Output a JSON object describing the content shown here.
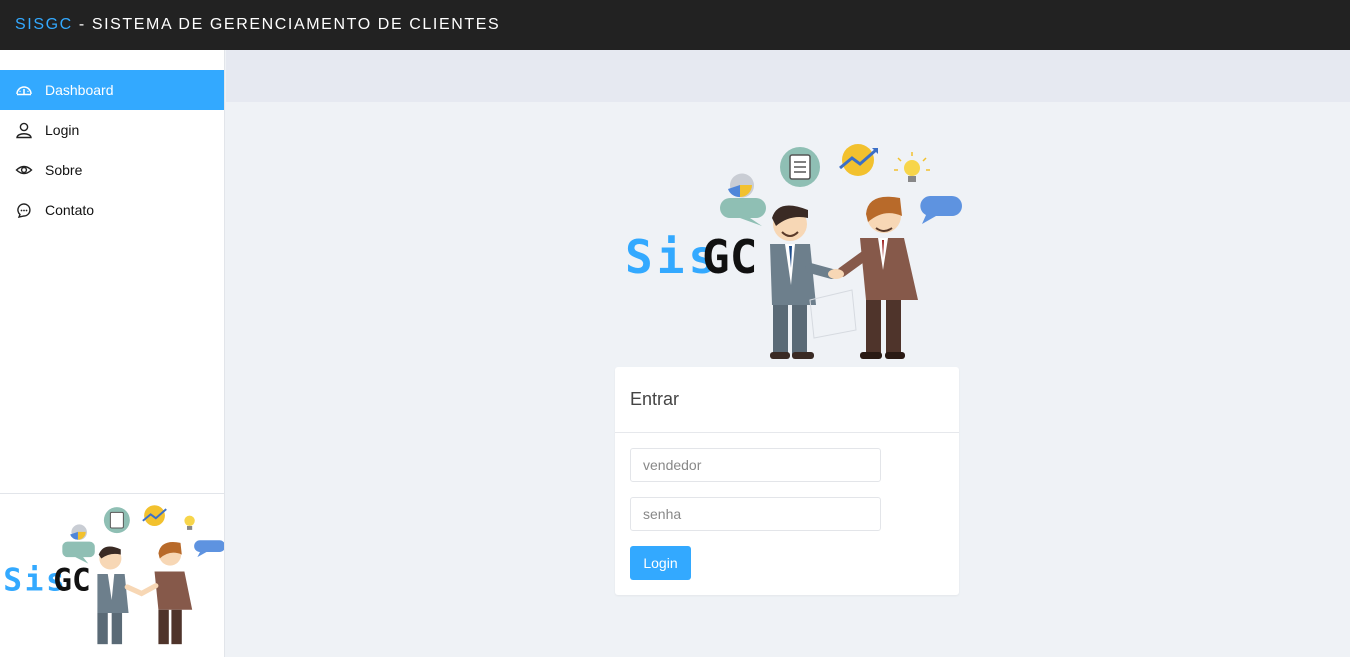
{
  "header": {
    "brand_accent": "SISGC",
    "brand_rest": " - SISTEMA DE GERENCIAMENTO DE CLIENTES"
  },
  "sidebar": {
    "items": [
      {
        "label": "Dashboard",
        "icon": "dashboard-icon",
        "active": true
      },
      {
        "label": "Login",
        "icon": "user-icon",
        "active": false
      },
      {
        "label": "Sobre",
        "icon": "eye-icon",
        "active": false
      },
      {
        "label": "Contato",
        "icon": "chat-icon",
        "active": false
      }
    ]
  },
  "logo": {
    "part1": "Sis",
    "part2": "GC"
  },
  "login": {
    "title": "Entrar",
    "user_placeholder": "vendedor",
    "pass_placeholder": "senha",
    "button_label": "Login"
  },
  "colors": {
    "accent": "#33a9ff",
    "topbar": "#222222",
    "content_bg": "#eff2f6"
  }
}
